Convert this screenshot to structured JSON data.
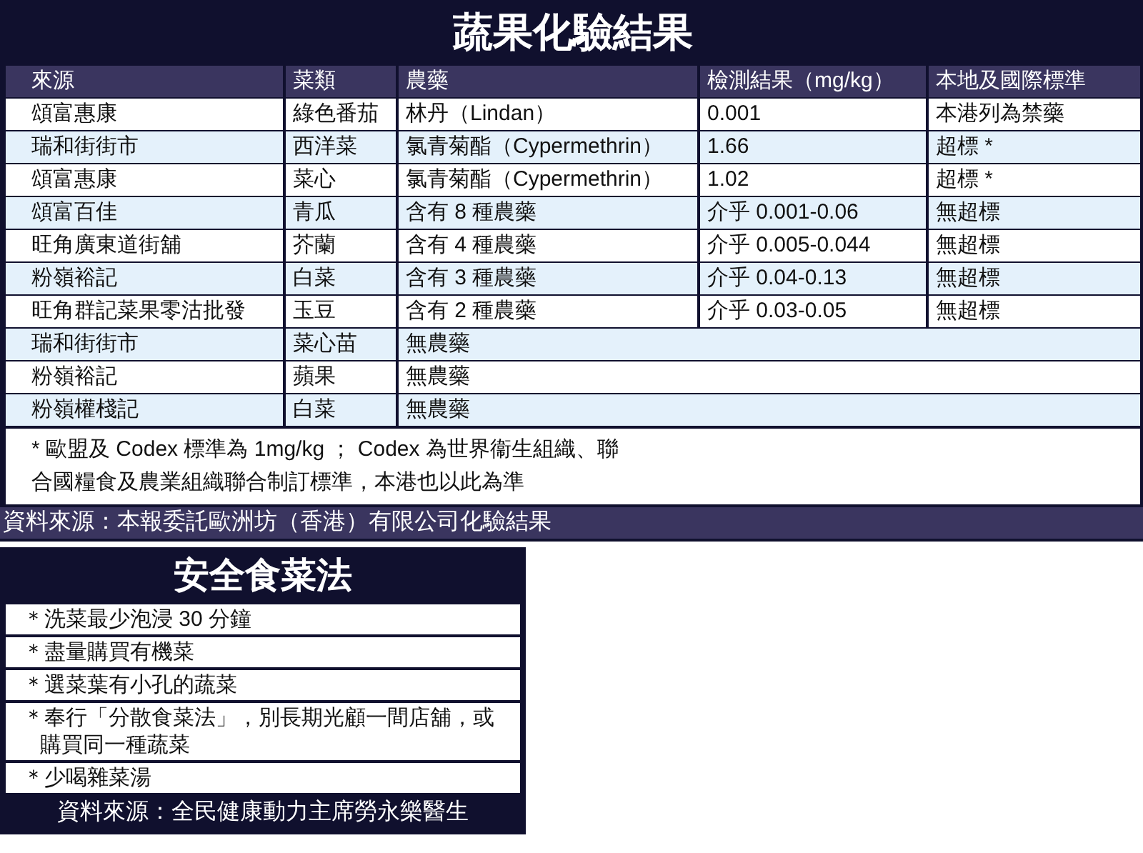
{
  "results": {
    "title": "蔬果化驗結果",
    "columns": [
      "來源",
      "菜類",
      "農藥",
      "檢測結果（mg/kg）",
      "本地及國際標準"
    ],
    "rows": [
      {
        "source": "頌富惠康",
        "vegetable": "綠色番茄",
        "pesticide": "林丹（Lindan）",
        "result": "0.001",
        "standard": "本港列為禁藥"
      },
      {
        "source": "瑞和街街市",
        "vegetable": "西洋菜",
        "pesticide": "氯青菊酯（Cypermethrin）",
        "result": "1.66",
        "standard": "超標 *"
      },
      {
        "source": "頌富惠康",
        "vegetable": "菜心",
        "pesticide": "氯青菊酯（Cypermethrin）",
        "result": "1.02",
        "standard": "超標 *"
      },
      {
        "source": "頌富百佳",
        "vegetable": "青瓜",
        "pesticide": "含有 8 種農藥",
        "result": "介乎 0.001-0.06",
        "standard": "無超標"
      },
      {
        "source": "旺角廣東道街舖",
        "vegetable": "芥蘭",
        "pesticide": "含有 4 種農藥",
        "result": "介乎 0.005-0.044",
        "standard": "無超標"
      },
      {
        "source": "粉嶺裕記",
        "vegetable": "白菜",
        "pesticide": "含有 3 種農藥",
        "result": "介乎 0.04-0.13",
        "standard": "無超標"
      },
      {
        "source": "旺角群記菜果零沽批發",
        "vegetable": "玉豆",
        "pesticide": "含有 2 種農藥",
        "result": "介乎 0.03-0.05",
        "standard": "無超標"
      },
      {
        "source": "瑞和街街市",
        "vegetable": "菜心苗",
        "pesticide": "無農藥"
      },
      {
        "source": "粉嶺裕記",
        "vegetable": "蘋果",
        "pesticide": "無農藥"
      },
      {
        "source": "粉嶺權棧記",
        "vegetable": "白菜",
        "pesticide": "無農藥"
      }
    ],
    "note": "* 歐盟及 Codex 標準為 1mg/kg ； Codex 為世界衞生組織、聯合國糧食及農業組織聯合制訂標準，本港也以此為準",
    "credit": "資料來源：本報委託歐洲坊（香港）有限公司化驗結果"
  },
  "tips": {
    "title": "安全食菜法",
    "items": [
      "＊洗菜最少泡浸 30 分鐘",
      "＊盡量購買有機菜",
      "＊選菜葉有小孔的蔬菜",
      "＊奉行「分散食菜法」，別長期光顧一間店舖，或購買同一種蔬菜",
      "＊少喝雜菜湯"
    ],
    "credit": "資料來源：全民健康動力主席勞永樂醫生"
  }
}
